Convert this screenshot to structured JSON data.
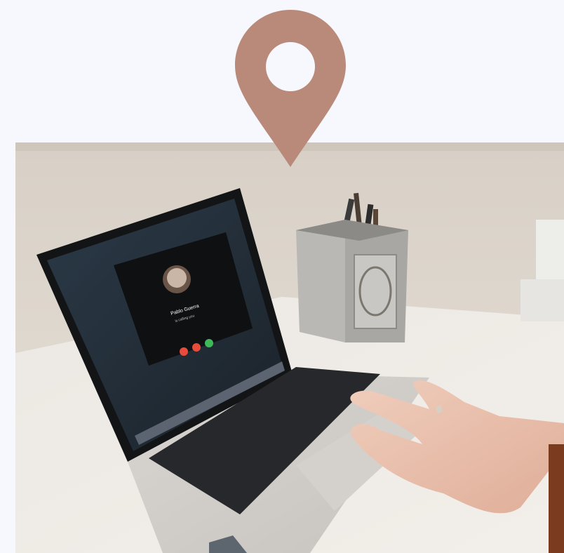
{
  "page": {
    "pin_icon": "map-pin-icon",
    "pin_color": "#b98a7a",
    "background_color": "#f6f8fd"
  },
  "photo": {
    "subject": "photo",
    "screen": {
      "caller_name": "Pablo Guerra",
      "call_status": "is calling you"
    }
  }
}
